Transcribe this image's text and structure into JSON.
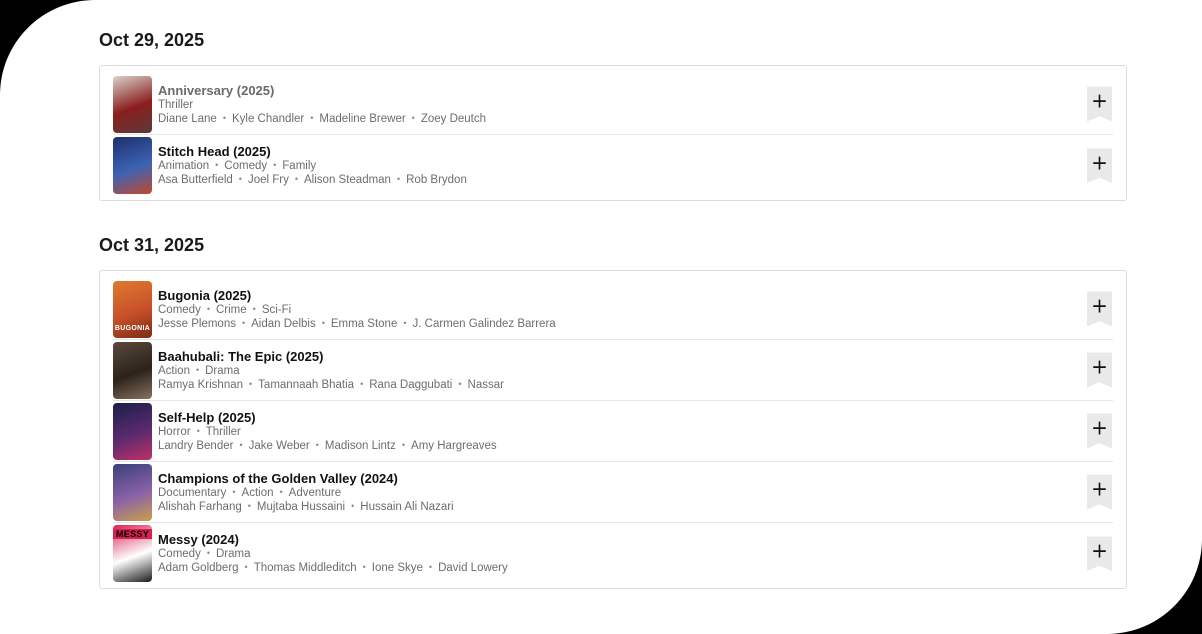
{
  "sections": [
    {
      "date": "Oct 29, 2025",
      "items": [
        {
          "title": "Anniversary (2025)",
          "genres": [
            "Thriller"
          ],
          "cast": [
            "Diane Lane",
            "Kyle Chandler",
            "Madeline Brewer",
            "Zoey Deutch"
          ],
          "poster_text": "",
          "poster_colors": [
            "#d9d2cc",
            "#8b1d1d",
            "#5a3a3a"
          ],
          "add_icon": "plus-icon"
        },
        {
          "title": "Stitch Head (2025)",
          "genres": [
            "Animation",
            "Comedy",
            "Family"
          ],
          "cast": [
            "Asa Butterfield",
            "Joel Fry",
            "Alison Steadman",
            "Rob Brydon"
          ],
          "poster_text": "",
          "poster_colors": [
            "#1e2f6b",
            "#3c63b5",
            "#c04a2a"
          ],
          "add_icon": "plus-icon"
        }
      ]
    },
    {
      "date": "Oct 31, 2025",
      "items": [
        {
          "title": "Bugonia (2025)",
          "genres": [
            "Comedy",
            "Crime",
            "Sci-Fi"
          ],
          "cast": [
            "Jesse Plemons",
            "Aidan Delbis",
            "Emma Stone",
            "J. Carmen Galindez Barrera"
          ],
          "poster_text": "BUGONIA",
          "poster_colors": [
            "#e07a2e",
            "#c8502a",
            "#7a2c14"
          ],
          "add_icon": "plus-icon"
        },
        {
          "title": "Baahubali: The Epic (2025)",
          "genres": [
            "Action",
            "Drama"
          ],
          "cast": [
            "Ramya Krishnan",
            "Tamannaah Bhatia",
            "Rana Daggubati",
            "Nassar"
          ],
          "poster_text": "",
          "poster_colors": [
            "#5a4a3c",
            "#2b221b",
            "#8a7260"
          ],
          "add_icon": "plus-icon"
        },
        {
          "title": "Self-Help (2025)",
          "genres": [
            "Horror",
            "Thriller"
          ],
          "cast": [
            "Landry Bender",
            "Jake Weber",
            "Madison Lintz",
            "Amy Hargreaves"
          ],
          "poster_text": "",
          "poster_colors": [
            "#1b1f4a",
            "#5b2a6e",
            "#c0306a"
          ],
          "add_icon": "plus-icon"
        },
        {
          "title": "Champions of the Golden Valley (2024)",
          "genres": [
            "Documentary",
            "Action",
            "Adventure"
          ],
          "cast": [
            "Alishah Farhang",
            "Mujtaba Hussaini",
            "Hussain Ali Nazari"
          ],
          "poster_text": "",
          "poster_colors": [
            "#3a3f7a",
            "#8a62a8",
            "#c9a04a"
          ],
          "add_icon": "plus-icon"
        },
        {
          "title": "Messy (2024)",
          "genres": [
            "Comedy",
            "Drama"
          ],
          "cast": [
            "Adam Goldberg",
            "Thomas Middleditch",
            "Ione Skye",
            "David Lowery"
          ],
          "poster_text": "MESSY",
          "poster_colors": [
            "#d81f4f",
            "#ffffff",
            "#1a1a1a"
          ],
          "add_icon": "plus-icon"
        }
      ]
    }
  ]
}
